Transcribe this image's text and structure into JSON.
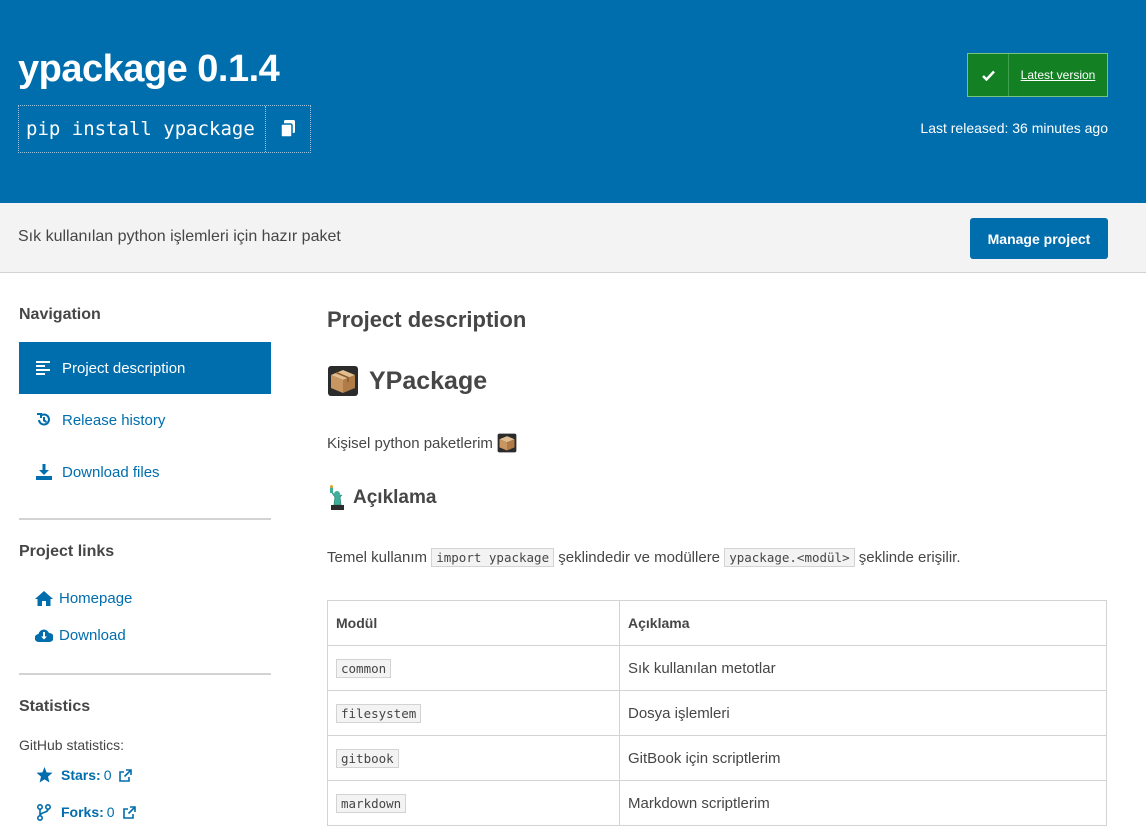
{
  "header": {
    "title": "ypackage 0.1.4",
    "pip_command": "pip install ypackage",
    "latest_badge": "Latest version",
    "last_released": "Last released: 36 minutes ago"
  },
  "summary": {
    "text": "Sık kullanılan python işlemleri için hazır paket",
    "manage_button": "Manage project"
  },
  "sidebar": {
    "navigation_heading": "Navigation",
    "nav_items": [
      {
        "label": "Project description",
        "icon": "align-left-icon",
        "active": true
      },
      {
        "label": "Release history",
        "icon": "history-icon",
        "active": false
      },
      {
        "label": "Download files",
        "icon": "download-icon",
        "active": false
      }
    ],
    "links_heading": "Project links",
    "links": [
      {
        "label": "Homepage",
        "icon": "home-icon"
      },
      {
        "label": "Download",
        "icon": "cloud-download-icon"
      }
    ],
    "statistics_heading": "Statistics",
    "github_label": "GitHub statistics:",
    "stats": [
      {
        "label": "Stars:",
        "value": "0",
        "icon": "star-icon"
      },
      {
        "label": "Forks:",
        "value": "0",
        "icon": "fork-icon"
      }
    ]
  },
  "main": {
    "section_title": "Project description",
    "heading": "YPackage",
    "intro": "Kişisel python paketlerim",
    "subheading": "Açıklama",
    "usage_prefix": "Temel kullanım",
    "usage_code1": "import ypackage",
    "usage_middle": "şeklindedir ve modüllere",
    "usage_code2": "ypackage.<modül>",
    "usage_suffix": "şeklinde erişilir.",
    "table": {
      "headers": [
        "Modül",
        "Açıklama"
      ],
      "rows": [
        [
          "common",
          "Sık kullanılan metotlar"
        ],
        [
          "filesystem",
          "Dosya işlemleri"
        ],
        [
          "gitbook",
          "GitBook için scriptlerim"
        ],
        [
          "markdown",
          "Markdown scriptlerim"
        ]
      ]
    }
  },
  "colors": {
    "brand_blue": "#006dad",
    "badge_green": "#148024",
    "band_gray": "#f3f3f3"
  }
}
